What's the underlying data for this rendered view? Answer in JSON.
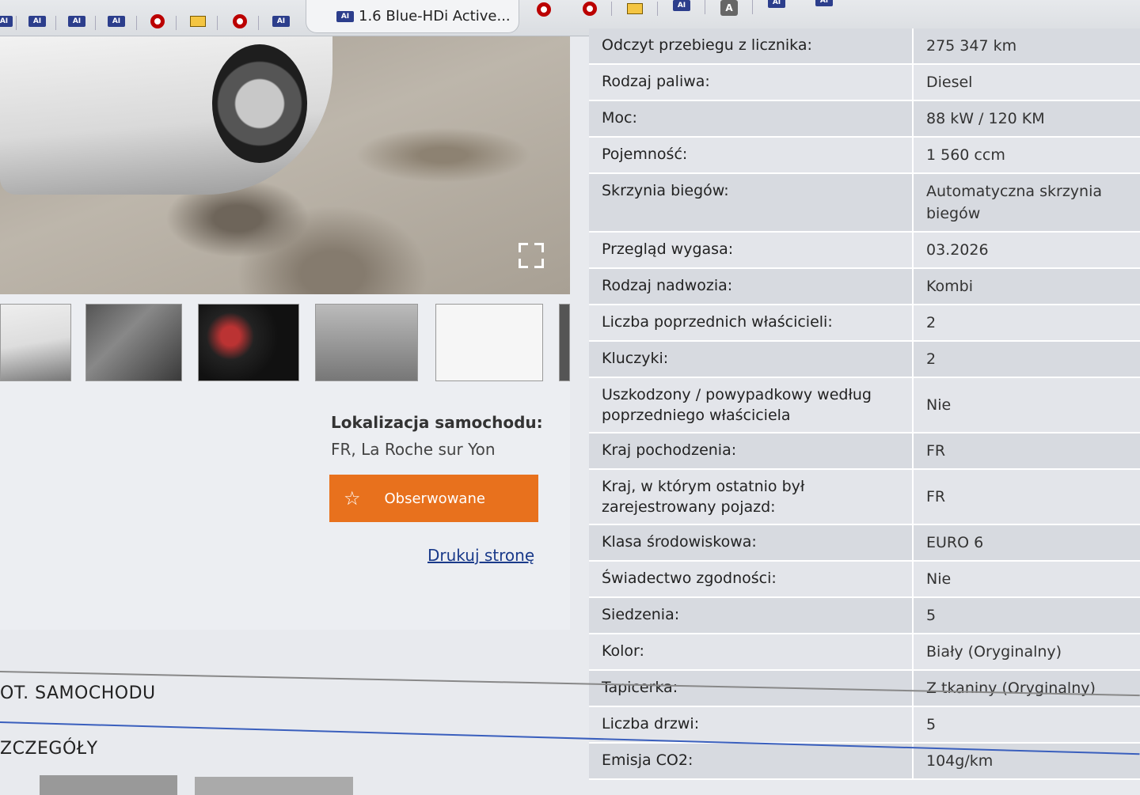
{
  "browser": {
    "active_tab_title": "1.6 Blue-HDi Active...",
    "pinned_tab_icons": [
      "ai-logo-icon",
      "ai-logo-icon",
      "ai-logo-icon",
      "opera-ring-icon",
      "mail-icon",
      "opera-ring-icon",
      "ai-logo-icon",
      "opera-ring-icon",
      "opera-ring-icon",
      "mail-icon",
      "ai-logo-icon",
      "avatar-icon",
      "ai-logo-icon",
      "ai-logo-icon"
    ],
    "avatar_letter": "A",
    "ai_logo_text": "AI"
  },
  "gallery": {
    "fullscreen_icon": "fullscreen-icon",
    "thumbnail_count": 6
  },
  "location": {
    "label": "Lokalizacja samochodu:",
    "value": "FR, La Roche sur Yon"
  },
  "actions": {
    "watch_label": "Obserwowane",
    "watch_icon": "star-icon",
    "print_label": "Drukuj stronę"
  },
  "specs": [
    {
      "key": "Odczyt przebiegu z licznika:",
      "value": "275 347 km"
    },
    {
      "key": "Rodzaj paliwa:",
      "value": "Diesel"
    },
    {
      "key": "Moc:",
      "value": "88 kW / 120 KM"
    },
    {
      "key": "Pojemność:",
      "value": "1 560 ccm"
    },
    {
      "key": "Skrzynia biegów:",
      "value": "Automatyczna skrzynia biegów"
    },
    {
      "key": "Przegląd wygasa:",
      "value": "03.2026"
    },
    {
      "key": "Rodzaj nadwozia:",
      "value": "Kombi"
    },
    {
      "key": "Liczba poprzednich właścicieli:",
      "value": "2"
    },
    {
      "key": "Kluczyki:",
      "value": "2"
    },
    {
      "key": "Uszkodzony / powypadkowy według poprzedniego właściciela",
      "value": "Nie"
    },
    {
      "key": "Kraj pochodzenia:",
      "value": "FR"
    },
    {
      "key": "Kraj, w którym ostatnio był zarejestrowany pojazd:",
      "value": "FR"
    },
    {
      "key": "Klasa środowiskowa:",
      "value": "EURO 6"
    },
    {
      "key": "Świadectwo zgodności:",
      "value": "Nie"
    },
    {
      "key": "Siedzenia:",
      "value": "5"
    },
    {
      "key": "Kolor:",
      "value": "Biały (Oryginalny)"
    },
    {
      "key": "Tapicerka:",
      "value": "Z tkaniny (Oryginalny)"
    },
    {
      "key": "Liczba drzwi:",
      "value": "5"
    },
    {
      "key": "Emisja CO2:",
      "value": "104g/km"
    }
  ],
  "sections": {
    "car_section": "OT. SAMOCHODU",
    "details_section": "ZCZEGÓŁY"
  }
}
